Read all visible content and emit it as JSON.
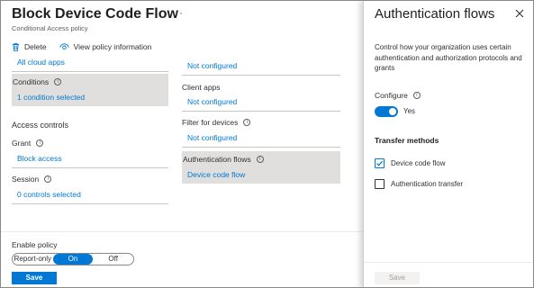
{
  "header": {
    "title": "Block Device Code Flow",
    "more": "···",
    "subtitle": "Conditional Access policy"
  },
  "toolbar": {
    "delete_label": "Delete",
    "view_label": "View policy information"
  },
  "left_column": {
    "cloud_apps_value": "All cloud apps",
    "conditions_label": "Conditions",
    "conditions_value": "1 condition selected",
    "access_controls_heading": "Access controls",
    "grant_label": "Grant",
    "grant_value": "Block access",
    "session_label": "Session",
    "session_value": "0 controls selected"
  },
  "right_column": {
    "top_value": "Not configured",
    "client_apps_label": "Client apps",
    "client_apps_value": "Not configured",
    "filter_devices_label": "Filter for devices",
    "filter_devices_value": "Not configured",
    "auth_flows_label": "Authentication flows",
    "auth_flows_value": "Device code flow"
  },
  "enable_policy": {
    "label": "Enable policy",
    "options": [
      "Report-only",
      "On",
      "Off"
    ],
    "selected": "On",
    "save_label": "Save"
  },
  "panel": {
    "title": "Authentication flows",
    "description": "Control how your organization uses certain authentication and authorization protocols and grants",
    "configure_label": "Configure",
    "configure_value": "Yes",
    "transfer_heading": "Transfer methods",
    "options": [
      {
        "label": "Device code flow",
        "checked": true
      },
      {
        "label": "Authentication transfer",
        "checked": false
      }
    ],
    "save_label": "Save"
  },
  "colors": {
    "accent": "#0078d4",
    "highlight": "#e1dfdd"
  },
  "icons": [
    "trash-icon",
    "eye-icon",
    "info-icon",
    "close-icon",
    "checkmark-icon"
  ]
}
